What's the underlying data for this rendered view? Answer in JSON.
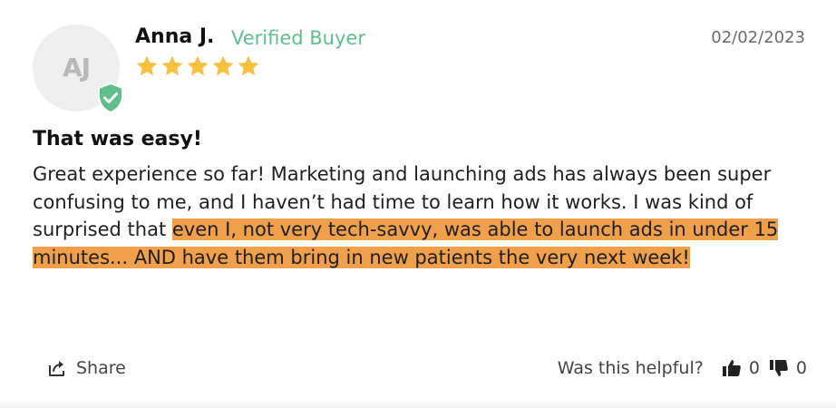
{
  "review": {
    "avatar_initials": "AJ",
    "author_name": "Anna J.",
    "verified_label": "Verified Buyer",
    "date": "02/02/2023",
    "rating": 5,
    "rating_max": 5,
    "title": "That was easy!",
    "body_plain": "Great experience so far! Marketing and launching ads has always been super confusing to me, and I haven’t had time to learn how it works. I was kind of surprised that ",
    "body_highlighted": "even I, not very tech-savvy, was able to launch ads in under 15 minutes... AND have them bring in new patients the very next week!"
  },
  "footer": {
    "share_label": "Share",
    "helpful_label": "Was this helpful?",
    "upvotes": "0",
    "downvotes": "0"
  },
  "colors": {
    "star": "#f6c23e",
    "verified": "#5fbf8a",
    "highlight": "#f0a04b",
    "avatar_bg": "#efefef"
  },
  "icons": {
    "verified_badge": "shield-check-icon",
    "star": "star-icon",
    "share": "share-icon",
    "thumbs_up": "thumbs-up-icon",
    "thumbs_down": "thumbs-down-icon"
  }
}
